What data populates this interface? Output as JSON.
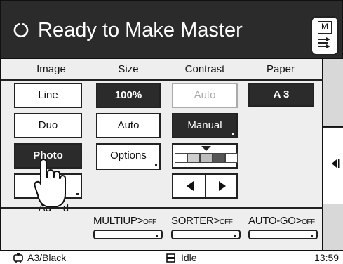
{
  "header": {
    "title": "Ready to Make Master",
    "master_button_letter": "M",
    "background_color": "#2b2b2b"
  },
  "columns": {
    "image": "Image",
    "size": "Size",
    "contrast": "Contrast",
    "paper": "Paper"
  },
  "image_modes": [
    {
      "label": "Line",
      "selected": false
    },
    {
      "label": "Duo",
      "selected": false
    },
    {
      "label": "Photo",
      "selected": true
    },
    {
      "label": "Ad    d",
      "selected": false
    }
  ],
  "size_options": [
    {
      "label": "100%",
      "selected": true
    },
    {
      "label": "Auto",
      "selected": false
    },
    {
      "label": "Options",
      "selected": false
    }
  ],
  "contrast": {
    "auto_label": "Auto",
    "manual_label": "Manual",
    "level": 3,
    "levels": 5
  },
  "paper": {
    "value": "A 3"
  },
  "toggles": [
    {
      "label": "MULTIUP>",
      "state": "OFF"
    },
    {
      "label": "SORTER>",
      "state": "OFF"
    },
    {
      "label": "AUTO-GO>",
      "state": "OFF"
    }
  ],
  "status": {
    "paper_ink": "A3/Black",
    "machine_state": "Idle",
    "time": "13:59"
  },
  "icons": {
    "title": "power-ring-icon",
    "master": "master-mode-icon",
    "side_tab": "side-arrow-icon",
    "status_left": "drum-icon",
    "status_mid": "printer-icon",
    "cursor": "hand-pointer-icon"
  }
}
